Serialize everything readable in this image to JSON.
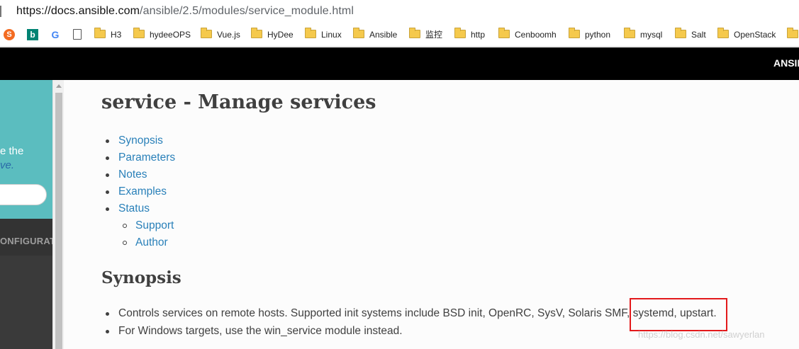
{
  "browser": {
    "url_host": "https://docs.ansible.com",
    "url_path": "/ansible/2.5/modules/service_module.html",
    "bookmarks": {
      "icons": [
        "sogou-icon",
        "bing-icon",
        "google-icon",
        "document-icon"
      ],
      "folders": [
        "H3",
        "hydeeOPS",
        "Vue.js",
        "HyDee",
        "Linux",
        "Ansible",
        "监控",
        "http",
        "Cenboomh",
        "python",
        "mysql",
        "Salt",
        "OpenStack"
      ]
    }
  },
  "header": {
    "brand": "ANSIB"
  },
  "sidebar": {
    "teal_text": "e the",
    "teal_link": "ve.",
    "nav_caption": "ONFIGURAT"
  },
  "content": {
    "title": "service - Manage services",
    "toc": {
      "items": [
        "Synopsis",
        "Parameters",
        "Notes",
        "Examples",
        "Status"
      ],
      "sub_items": [
        "Support",
        "Author"
      ]
    },
    "synopsis_heading": "Synopsis",
    "synopsis_items": [
      "Controls services on remote hosts. Supported init systems include BSD init, OpenRC, SysV, Solaris SMF, systemd, upstart.",
      "For Windows targets, use the win_service module instead."
    ]
  },
  "watermark": "https://blog.csdn.net/sawyerlan",
  "colors": {
    "link": "#2980b9",
    "sidebar_teal": "#5bbdbf",
    "highlight": "#e3191b"
  }
}
